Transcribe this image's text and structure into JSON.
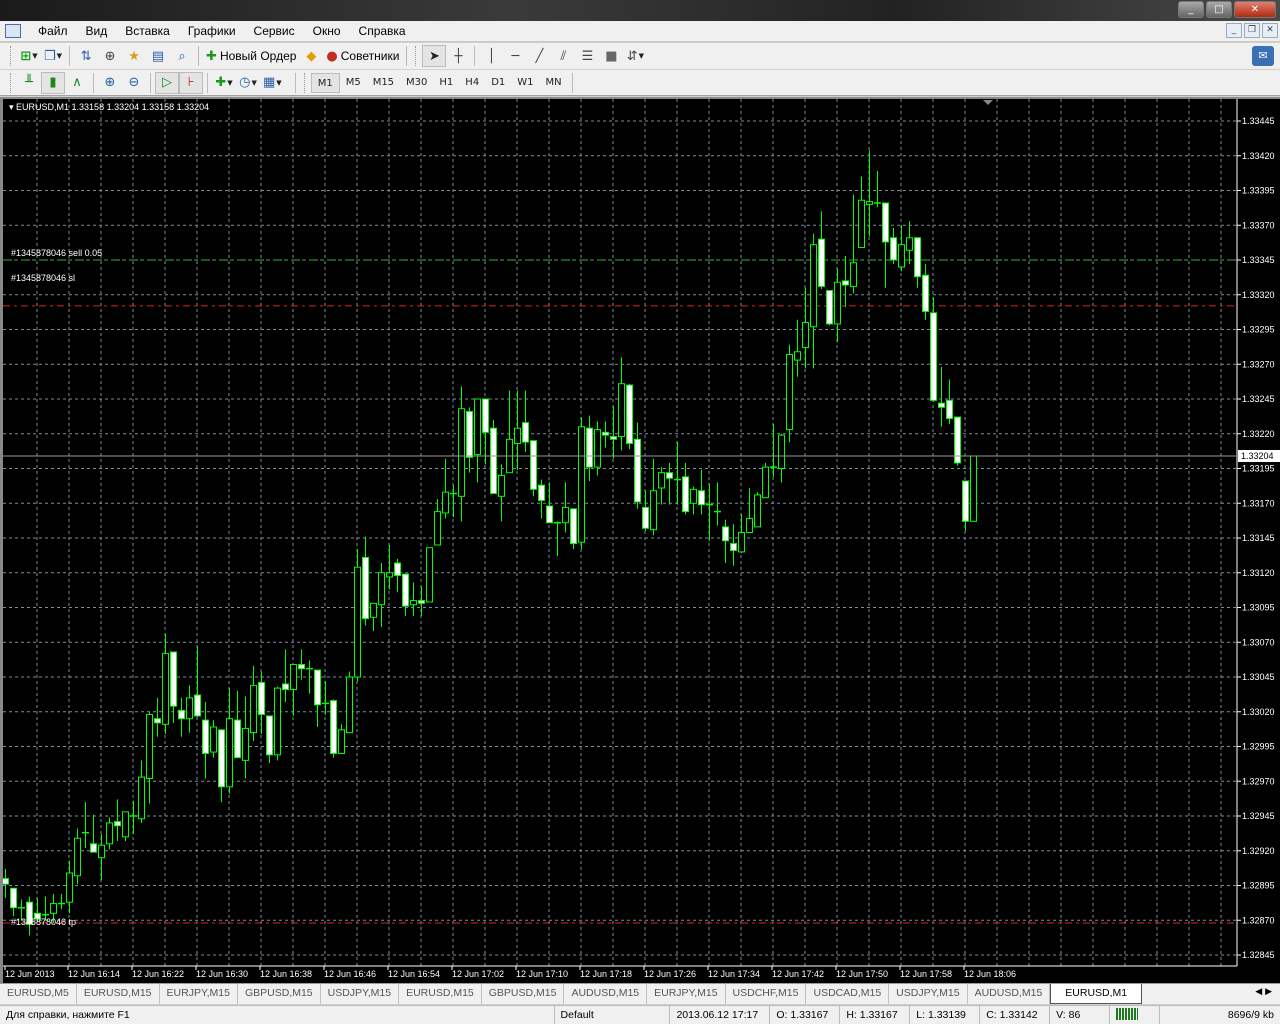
{
  "menu": [
    "Файл",
    "Вид",
    "Вставка",
    "Графики",
    "Сервис",
    "Окно",
    "Справка"
  ],
  "toolbar": {
    "new_order": "Новый Ордер",
    "experts": "Советники"
  },
  "timeframes": [
    "M1",
    "M5",
    "M15",
    "M30",
    "H1",
    "H4",
    "D1",
    "W1",
    "MN"
  ],
  "active_timeframe": "M1",
  "chart_header": "EURUSD,M1  1.33158 1.33204 1.33158 1.33204",
  "order_lines": {
    "sell": "#1345878046 sell 0.05",
    "sl": "#1345878046 sl",
    "tp": "#1345878046 tp"
  },
  "colors": {
    "bg": "#000000",
    "candle": "#00ff00",
    "bear_fill": "#ffffff",
    "grid": "#7f8c99",
    "sell_line": "#22bb22",
    "sl_tp_line": "#dd2222"
  },
  "tabs": [
    "EURUSD,M5",
    "EURUSD,M15",
    "EURJPY,M15",
    "GBPUSD,M15",
    "USDJPY,M15",
    "EURUSD,M15",
    "GBPUSD,M15",
    "AUDUSD,M15",
    "EURJPY,M15",
    "USDCHF,M15",
    "USDCAD,M15",
    "USDJPY,M15",
    "AUDUSD,M15",
    "EURUSD,M1"
  ],
  "active_tab": "EURUSD,M1",
  "status": {
    "help": "Для справки, нажмите F1",
    "profile": "Default",
    "time": "2013.06.12 17:17",
    "open": "O: 1.33167",
    "high": "H: 1.33167",
    "low": "L: 1.33139",
    "close": "C: 1.33142",
    "volume": "V: 86",
    "traffic": "8696/9 kb"
  },
  "chart_data": {
    "type": "candlestick",
    "symbol": "EURUSD",
    "timeframe": "M1",
    "ylim": [
      1.32845,
      1.33445
    ],
    "y_ticks": [
      "1.33445",
      "1.33420",
      "1.33395",
      "1.33370",
      "1.33345",
      "1.33320",
      "1.33295",
      "1.33270",
      "1.33245",
      "1.33220",
      "1.33195",
      "1.33170",
      "1.33145",
      "1.33120",
      "1.33095",
      "1.33070",
      "1.33045",
      "1.33020",
      "1.32995",
      "1.32970",
      "1.32945",
      "1.32920",
      "1.32895",
      "1.32870",
      "1.32845"
    ],
    "x_ticks": [
      "12 Jun 2013",
      "12 Jun 16:14",
      "12 Jun 16:22",
      "12 Jun 16:30",
      "12 Jun 16:38",
      "12 Jun 16:46",
      "12 Jun 16:54",
      "12 Jun 17:02",
      "12 Jun 17:10",
      "12 Jun 17:18",
      "12 Jun 17:26",
      "12 Jun 17:34",
      "12 Jun 17:42",
      "12 Jun 17:50",
      "12 Jun 17:58",
      "12 Jun 18:06"
    ],
    "current_price": "1.33204",
    "sell_price": 1.33345,
    "sl_price": 1.33312,
    "tp_price": 1.32868,
    "ohlc": [
      [
        1.329,
        1.32907,
        1.32886,
        1.32896
      ],
      [
        1.32893,
        1.32893,
        1.32873,
        1.32879
      ],
      [
        1.32879,
        1.32885,
        1.3287,
        1.32878
      ],
      [
        1.32883,
        1.32887,
        1.32859,
        1.32867
      ],
      [
        1.32875,
        1.32886,
        1.32869,
        1.32871
      ],
      [
        1.32874,
        1.32887,
        1.3287,
        1.32873
      ],
      [
        1.32875,
        1.32889,
        1.32868,
        1.32882
      ],
      [
        1.32881,
        1.32889,
        1.32878,
        1.32882
      ],
      [
        1.32883,
        1.32913,
        1.32875,
        1.32904
      ],
      [
        1.32902,
        1.32936,
        1.32896,
        1.32929
      ],
      [
        1.32932,
        1.32955,
        1.32922,
        1.32933
      ],
      [
        1.32925,
        1.32946,
        1.32919,
        1.32919
      ],
      [
        1.32915,
        1.32932,
        1.32899,
        1.32924
      ],
      [
        1.32925,
        1.32944,
        1.32921,
        1.3294
      ],
      [
        1.32941,
        1.32957,
        1.32927,
        1.32938
      ],
      [
        1.3293,
        1.32948,
        1.32927,
        1.32948
      ],
      [
        1.32944,
        1.32956,
        1.32932,
        1.32945
      ],
      [
        1.32943,
        1.32985,
        1.3294,
        1.32973
      ],
      [
        1.32972,
        1.3302,
        1.32954,
        1.33018
      ],
      [
        1.33015,
        1.3303,
        1.33002,
        1.33012
      ],
      [
        1.33011,
        1.33076,
        1.33004,
        1.33062
      ],
      [
        1.33063,
        1.33063,
        1.33012,
        1.33024
      ],
      [
        1.33021,
        1.3303,
        1.33002,
        1.33015
      ],
      [
        1.33015,
        1.33039,
        1.33005,
        1.3303
      ],
      [
        1.33032,
        1.33067,
        1.33016,
        1.33017
      ],
      [
        1.33014,
        1.33027,
        1.32972,
        1.3299
      ],
      [
        1.32991,
        1.33014,
        1.32987,
        1.33009
      ],
      [
        1.33007,
        1.33007,
        1.32955,
        1.32966
      ],
      [
        1.32966,
        1.33037,
        1.32961,
        1.33015
      ],
      [
        1.33014,
        1.33035,
        1.32987,
        1.32987
      ],
      [
        1.32985,
        1.33031,
        1.32972,
        1.33008
      ],
      [
        1.33005,
        1.33053,
        1.32999,
        1.33039
      ],
      [
        1.33041,
        1.33049,
        1.33004,
        1.33018
      ],
      [
        1.33017,
        1.33017,
        1.32983,
        1.32989
      ],
      [
        1.32989,
        1.33038,
        1.32985,
        1.33037
      ],
      [
        1.3304,
        1.33065,
        1.33027,
        1.33036
      ],
      [
        1.33036,
        1.33054,
        1.33017,
        1.33054
      ],
      [
        1.33054,
        1.33065,
        1.33043,
        1.33051
      ],
      [
        1.33051,
        1.33057,
        1.33033,
        1.3305
      ],
      [
        1.3305,
        1.3305,
        1.33009,
        1.33025
      ],
      [
        1.33026,
        1.33042,
        1.33018,
        1.33025
      ],
      [
        1.33028,
        1.33029,
        1.32987,
        1.3299
      ],
      [
        1.3299,
        1.33011,
        1.3299,
        1.33007
      ],
      [
        1.33005,
        1.33049,
        1.33005,
        1.33045
      ],
      [
        1.33045,
        1.33137,
        1.33042,
        1.33124
      ],
      [
        1.33131,
        1.33146,
        1.33082,
        1.33087
      ],
      [
        1.33088,
        1.33098,
        1.33078,
        1.33098
      ],
      [
        1.33097,
        1.33127,
        1.33081,
        1.3312
      ],
      [
        1.33117,
        1.3314,
        1.33108,
        1.3312
      ],
      [
        1.33127,
        1.3313,
        1.33106,
        1.33118
      ],
      [
        1.33119,
        1.33119,
        1.33089,
        1.33096
      ],
      [
        1.33097,
        1.33113,
        1.33089,
        1.331
      ],
      [
        1.331,
        1.3311,
        1.33089,
        1.33098
      ],
      [
        1.33099,
        1.33138,
        1.33099,
        1.33138
      ],
      [
        1.3314,
        1.33173,
        1.3314,
        1.33164
      ],
      [
        1.33163,
        1.33202,
        1.33159,
        1.33178
      ],
      [
        1.33177,
        1.33183,
        1.3316,
        1.33176
      ],
      [
        1.33175,
        1.33254,
        1.33157,
        1.33238
      ],
      [
        1.33236,
        1.33239,
        1.33192,
        1.33203
      ],
      [
        1.33205,
        1.33245,
        1.33185,
        1.33245
      ],
      [
        1.33245,
        1.33245,
        1.33198,
        1.33221
      ],
      [
        1.33224,
        1.3323,
        1.33177,
        1.33177
      ],
      [
        1.33175,
        1.33198,
        1.33157,
        1.3319
      ],
      [
        1.33192,
        1.33251,
        1.33192,
        1.33216
      ],
      [
        1.33213,
        1.33251,
        1.33194,
        1.33224
      ],
      [
        1.33228,
        1.33251,
        1.33207,
        1.33214
      ],
      [
        1.33215,
        1.33215,
        1.33175,
        1.3318
      ],
      [
        1.33183,
        1.33187,
        1.33159,
        1.33172
      ],
      [
        1.33168,
        1.33185,
        1.33156,
        1.33156
      ],
      [
        1.33156,
        1.33157,
        1.33132,
        1.33155
      ],
      [
        1.33156,
        1.33185,
        1.33149,
        1.33167
      ],
      [
        1.33166,
        1.33166,
        1.33137,
        1.33141
      ],
      [
        1.33142,
        1.33232,
        1.33137,
        1.33225
      ],
      [
        1.33224,
        1.33233,
        1.33186,
        1.33196
      ],
      [
        1.33196,
        1.33229,
        1.3319,
        1.33223
      ],
      [
        1.33221,
        1.33229,
        1.3321,
        1.33219
      ],
      [
        1.33218,
        1.3324,
        1.33202,
        1.33216
      ],
      [
        1.33218,
        1.33275,
        1.33208,
        1.33256
      ],
      [
        1.33255,
        1.33256,
        1.33209,
        1.33213
      ],
      [
        1.33216,
        1.33228,
        1.33166,
        1.33171
      ],
      [
        1.33167,
        1.33179,
        1.3315,
        1.33152
      ],
      [
        1.33151,
        1.33202,
        1.33147,
        1.33179
      ],
      [
        1.33181,
        1.33196,
        1.33169,
        1.33192
      ],
      [
        1.33192,
        1.33199,
        1.33169,
        1.33188
      ],
      [
        1.33187,
        1.33214,
        1.33169,
        1.33186
      ],
      [
        1.33189,
        1.33199,
        1.33162,
        1.33164
      ],
      [
        1.3317,
        1.33182,
        1.33162,
        1.3318
      ],
      [
        1.33179,
        1.33194,
        1.33162,
        1.33169
      ],
      [
        1.33169,
        1.33184,
        1.33143,
        1.33168
      ],
      [
        1.33164,
        1.33185,
        1.33154,
        1.33163
      ],
      [
        1.33153,
        1.33158,
        1.33127,
        1.33143
      ],
      [
        1.33141,
        1.33155,
        1.33125,
        1.33136
      ],
      [
        1.33135,
        1.33162,
        1.33134,
        1.33149
      ],
      [
        1.33149,
        1.33181,
        1.33149,
        1.33159
      ],
      [
        1.33153,
        1.33178,
        1.33153,
        1.33176
      ],
      [
        1.33174,
        1.33199,
        1.33174,
        1.33196
      ],
      [
        1.33196,
        1.33227,
        1.33189,
        1.33195
      ],
      [
        1.33195,
        1.3322,
        1.33185,
        1.33219
      ],
      [
        1.33223,
        1.33284,
        1.33214,
        1.33277
      ],
      [
        1.33273,
        1.33302,
        1.33261,
        1.33279
      ],
      [
        1.33282,
        1.33325,
        1.33267,
        1.333
      ],
      [
        1.33297,
        1.33364,
        1.33267,
        1.33356
      ],
      [
        1.3336,
        1.3338,
        1.33324,
        1.33326
      ],
      [
        1.33323,
        1.33323,
        1.33298,
        1.33299
      ],
      [
        1.33299,
        1.33339,
        1.33286,
        1.33329
      ],
      [
        1.3333,
        1.33348,
        1.33311,
        1.33327
      ],
      [
        1.33326,
        1.33392,
        1.33321,
        1.33343
      ],
      [
        1.33354,
        1.33405,
        1.33354,
        1.33388
      ],
      [
        1.33385,
        1.33424,
        1.33362,
        1.33387
      ],
      [
        1.33386,
        1.33409,
        1.33383,
        1.33385
      ],
      [
        1.33386,
        1.33386,
        1.33325,
        1.33358
      ],
      [
        1.33361,
        1.33368,
        1.33342,
        1.33345
      ],
      [
        1.3334,
        1.3337,
        1.33337,
        1.33356
      ],
      [
        1.33352,
        1.33373,
        1.33342,
        1.33361
      ],
      [
        1.33361,
        1.33361,
        1.33325,
        1.33333
      ],
      [
        1.33334,
        1.33342,
        1.33302,
        1.33308
      ],
      [
        1.33307,
        1.33318,
        1.33243,
        1.33244
      ],
      [
        1.33242,
        1.33268,
        1.33225,
        1.33239
      ],
      [
        1.33244,
        1.33259,
        1.33227,
        1.33231
      ],
      [
        1.33232,
        1.33232,
        1.33197,
        1.33199
      ],
      [
        1.33186,
        1.33186,
        1.3315,
        1.33157
      ],
      [
        1.33157,
        1.33204,
        1.33157,
        1.33204
      ]
    ]
  }
}
